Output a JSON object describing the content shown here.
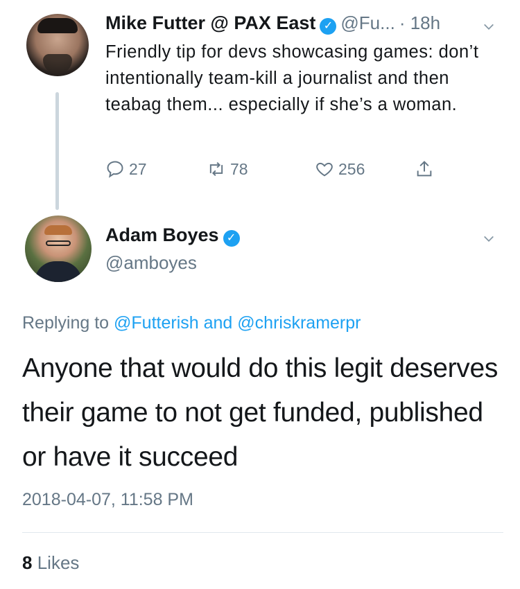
{
  "parent_tweet": {
    "author_name": "Mike Futter @ PAX East",
    "handle": "@Fu...",
    "time": "· 18h",
    "text": "Friendly tip for devs showcasing games: don’t intentionally team-kill a journalist and then teabag them... especially if she’s a woman.",
    "reply_count": "27",
    "retweet_count": "78",
    "like_count": "256"
  },
  "main_tweet": {
    "author_name": "Adam Boyes",
    "handle": "@amboyes",
    "replying_prefix": "Replying to",
    "replying_to_1": "@Futterish",
    "replying_and": "and",
    "replying_to_2": "@chriskramerpr",
    "text": "Anyone that would do this legit deserves their game to not get funded, published or have it succeed",
    "timestamp": "2018-04-07, 11:58 PM",
    "likes_count": "8",
    "likes_label": "Likes"
  },
  "colors": {
    "accent": "#1da1f2",
    "muted": "#657786",
    "text": "#14171a",
    "thread_line": "#ccd6dd"
  }
}
